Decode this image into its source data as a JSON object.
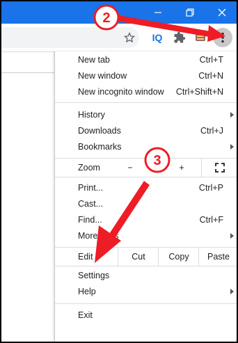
{
  "window": {
    "minimize_icon": "minimize-icon",
    "restore_icon": "restore-icon",
    "close_icon": "close-icon",
    "titlebar_color": "#1a73e8"
  },
  "toolbar": {
    "star_icon": "star-icon",
    "iq_label": "IQ",
    "puzzle_icon": "puzzle-icon",
    "menu_icon": "kebab-menu-icon"
  },
  "menu": {
    "group1": [
      {
        "label": "New tab",
        "shortcut": "Ctrl+T"
      },
      {
        "label": "New window",
        "shortcut": "Ctrl+N"
      },
      {
        "label": "New incognito window",
        "shortcut": "Ctrl+Shift+N"
      }
    ],
    "group2": [
      {
        "label": "History",
        "shortcut": ""
      },
      {
        "label": "Downloads",
        "shortcut": "Ctrl+J"
      },
      {
        "label": "Bookmarks",
        "shortcut": ""
      }
    ],
    "zoom": {
      "label": "Zoom",
      "minus": "−",
      "plus": "+"
    },
    "group3": [
      {
        "label": "Print...",
        "shortcut": "Ctrl+P"
      },
      {
        "label": "Cast...",
        "shortcut": ""
      },
      {
        "label": "Find...",
        "shortcut": "Ctrl+F"
      },
      {
        "label": "More tools",
        "shortcut": ""
      }
    ],
    "edit": {
      "label": "Edit",
      "cut": "Cut",
      "copy": "Copy",
      "paste": "Paste"
    },
    "group4": [
      {
        "label": "Settings"
      },
      {
        "label": "Help"
      }
    ],
    "exit": "Exit"
  },
  "annotations": {
    "step2": "2",
    "step3": "3",
    "accent": "#ee1c25"
  }
}
